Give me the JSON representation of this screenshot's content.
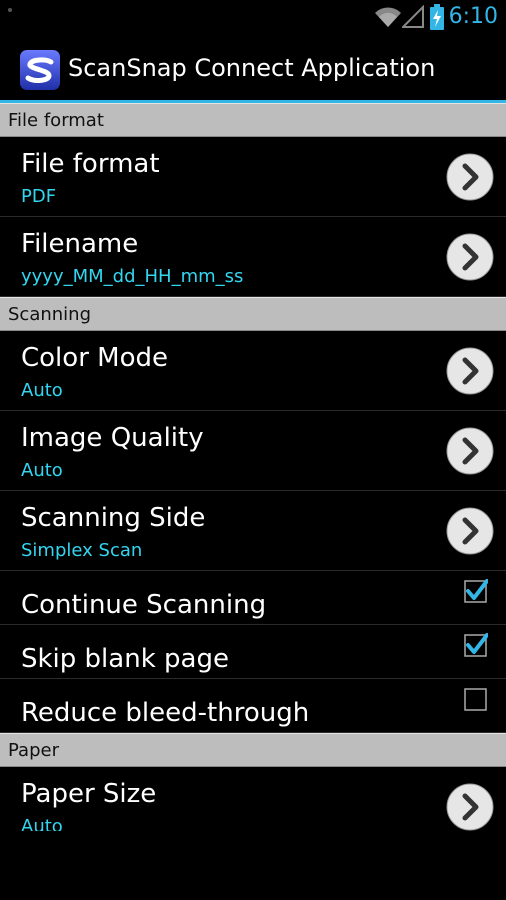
{
  "status_bar": {
    "time": "6:10"
  },
  "action_bar": {
    "title": "ScanSnap Connect Application"
  },
  "sections": [
    {
      "header": "File format"
    },
    {
      "header": "Scanning"
    },
    {
      "header": "Paper"
    }
  ],
  "prefs": {
    "file_format": {
      "title": "File format",
      "summary": "PDF"
    },
    "filename": {
      "title": "Filename",
      "summary": "yyyy_MM_dd_HH_mm_ss"
    },
    "color_mode": {
      "title": "Color Mode",
      "summary": "Auto"
    },
    "image_quality": {
      "title": "Image Quality",
      "summary": "Auto"
    },
    "scanning_side": {
      "title": "Scanning Side",
      "summary": "Simplex Scan"
    },
    "continue_scanning": {
      "title": "Continue Scanning",
      "checked": true
    },
    "skip_blank_page": {
      "title": "Skip blank page",
      "checked": true
    },
    "reduce_bleed_through": {
      "title": "Reduce bleed-through",
      "checked": false
    },
    "paper_size": {
      "title": "Paper Size",
      "summary": "Auto"
    }
  },
  "colors": {
    "accent": "#33b5e5",
    "summary": "#33d6f0",
    "section_bg": "#bdbdbd"
  }
}
